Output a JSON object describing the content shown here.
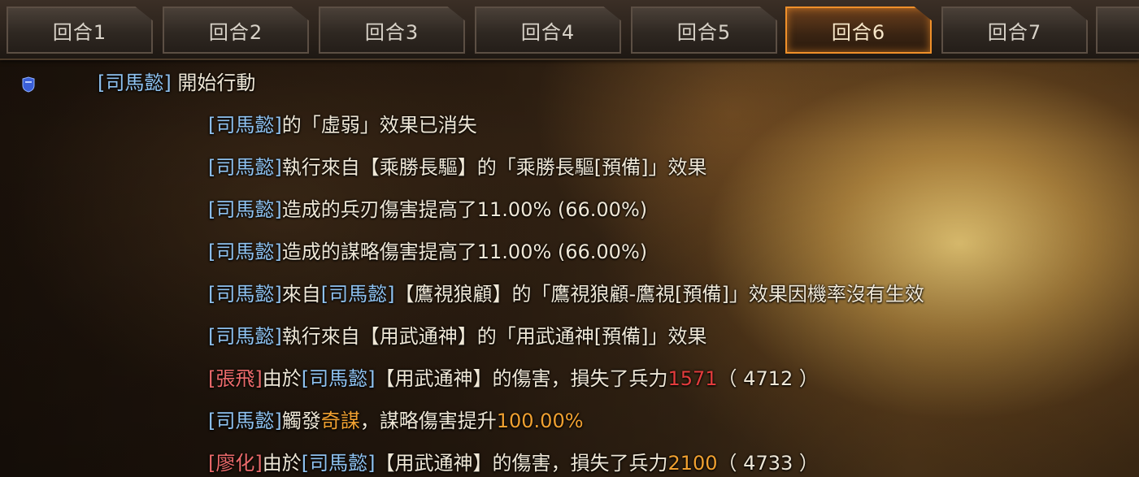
{
  "tabs": [
    "回合1",
    "回合2",
    "回合3",
    "回合4",
    "回合5",
    "回合6",
    "回合7"
  ],
  "active_tab": "回合6",
  "log": {
    "line1": {
      "name": "[司馬懿]",
      "text": " 開始行動"
    },
    "line2": {
      "name": "[司馬懿]",
      "text": "的「虛弱」效果已消失"
    },
    "line3": {
      "name": "[司馬懿]",
      "text": "執行來自【乘勝長驅】的「乘勝長驅[預備]」效果"
    },
    "line4": {
      "name": "[司馬懿]",
      "text": "造成的兵刃傷害提高了11.00% (66.00%)"
    },
    "line5": {
      "name": "[司馬懿]",
      "text": "造成的謀略傷害提高了11.00% (66.00%)"
    },
    "line6": {
      "name": "[司馬懿]",
      "mid": "來自",
      "name2": "[司馬懿]",
      "text": "【鷹視狼顧】的「鷹視狼顧-鷹視[預備]」效果因機率沒有生效"
    },
    "line7": {
      "name": "[司馬懿]",
      "text": "執行來自【用武通神】的「用武通神[預備]」效果"
    },
    "line8": {
      "name": "[張飛]",
      "mid": "由於",
      "name2": "[司馬懿]",
      "text": "【用武通神】的傷害，損失了兵力",
      "num": "1571",
      "rest": "（ 4712 ）"
    },
    "line9": {
      "name": "[司馬懿]",
      "mid": "觸發",
      "skill": "奇謀",
      "text": "，謀略傷害提升",
      "pct": "100.00%"
    },
    "line10": {
      "name": "[廖化]",
      "mid": "由於",
      "name2": "[司馬懿]",
      "text": "【用武通神】的傷害，損失了兵力",
      "num": "2100",
      "rest": "（ 4733 ）"
    }
  },
  "icon": "blue-shield-icon"
}
